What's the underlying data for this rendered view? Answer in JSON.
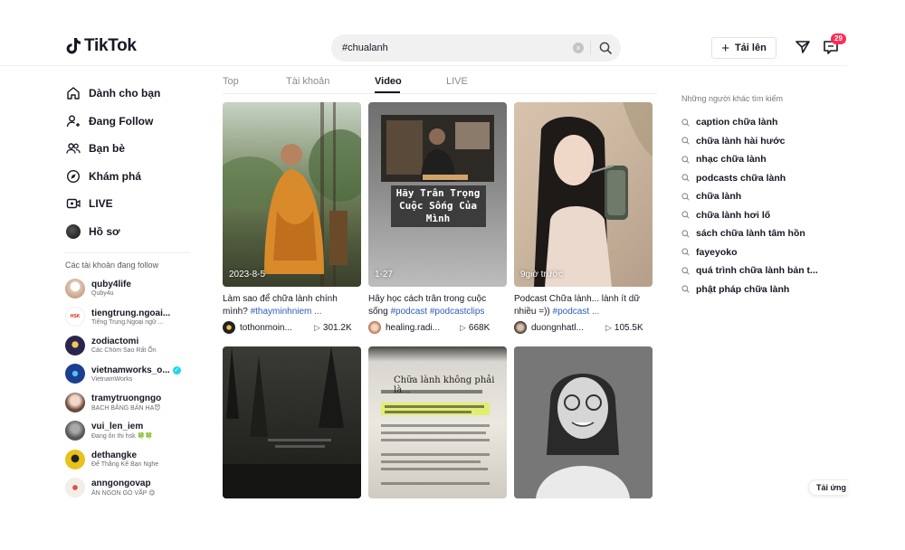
{
  "header": {
    "logo_text": "TikTok",
    "search_value": "#chualanh",
    "upload_label": "Tải lên",
    "inbox_count": "29"
  },
  "sidebar": {
    "nav": [
      {
        "label": "Dành cho bạn",
        "icon": "home-icon"
      },
      {
        "label": "Đang Follow",
        "icon": "user-follow-icon"
      },
      {
        "label": "Bạn bè",
        "icon": "friends-icon"
      },
      {
        "label": "Khám phá",
        "icon": "compass-icon"
      },
      {
        "label": "LIVE",
        "icon": "live-icon"
      },
      {
        "label": "Hồ sơ",
        "icon": "profile-avatar"
      }
    ],
    "following_title": "Các tài khoản đang follow",
    "accounts": [
      {
        "name": "quby4life",
        "sub": "Quby4u",
        "verified": false,
        "color": "#e8d6c6"
      },
      {
        "name": "tiengtrung.ngoai...",
        "sub": "Tiếng Trung.Ngoại ngữ ...",
        "verified": false,
        "color": "#ffffff"
      },
      {
        "name": "zodiactomi",
        "sub": "Các Chòm Sao Rất Ổn",
        "verified": false,
        "color": "#2a2550"
      },
      {
        "name": "vietnamworks_o...",
        "sub": "VietnamWorks",
        "verified": true,
        "color": "#1b3f8f"
      },
      {
        "name": "tramytruongngo",
        "sub": "BẠCH BĂNG BẢN HẠ😈",
        "verified": false,
        "color": "#d9b8a8"
      },
      {
        "name": "vui_len_iem",
        "sub": "Đang ôn thi hsk 🍀🍀",
        "verified": false,
        "color": "#6d6d6d"
      },
      {
        "name": "dethangke",
        "sub": "Để Thằng Kể Bạn Nghe",
        "verified": false,
        "color": "#e8c21a"
      },
      {
        "name": "anngongovap",
        "sub": "ĂN NGON GÒ VẤP 😋",
        "verified": false,
        "color": "#f4efe6"
      }
    ]
  },
  "tabs": [
    "Top",
    "Tài khoản",
    "Video",
    "LIVE"
  ],
  "active_tab": "Video",
  "videos": [
    {
      "label": "2023-8-5",
      "desc_plain": "Làm sao để chữa lành chính mình? ",
      "desc_tag": "#thayminhniem ...",
      "user": "tothonmoin...",
      "views": "301.2K",
      "overlay": ""
    },
    {
      "label": "1-27",
      "desc_plain": "Hãy học cách trân trong cuộc sống ",
      "desc_tag": "#podcast #podcastclips",
      "user": "healing.radi...",
      "views": "668K",
      "overlay": "Hãy Trân Trọng Cuộc Sống Của Mình"
    },
    {
      "label": "9giờ trước",
      "desc_plain": "Podcast Chữa lành... lành ít dữ nhiều =)) ",
      "desc_tag": "#podcast ...",
      "user": "duongnhatl...",
      "views": "105.5K",
      "overlay": ""
    },
    {
      "label": "",
      "overlay": ""
    },
    {
      "label": "",
      "overlay": "Chữa lành không phải là..."
    },
    {
      "label": "",
      "overlay": ""
    }
  ],
  "right_panel": {
    "title": "Những người khác tìm kiếm",
    "suggestions": [
      "caption chữa lành",
      "chữa lành hài hước",
      "nhạc chữa lành",
      "podcasts chữa lành",
      "chữa lành",
      "chữa lành hơi lố",
      "sách chữa lành tâm hồn",
      "fayeyoko",
      "quá trình chữa lành bản t...",
      "phật pháp chữa lành"
    ]
  },
  "download_label": "Tải ứng dụng",
  "colors": {
    "accent": "#fe2c55",
    "hashtag": "#2b5db9"
  }
}
